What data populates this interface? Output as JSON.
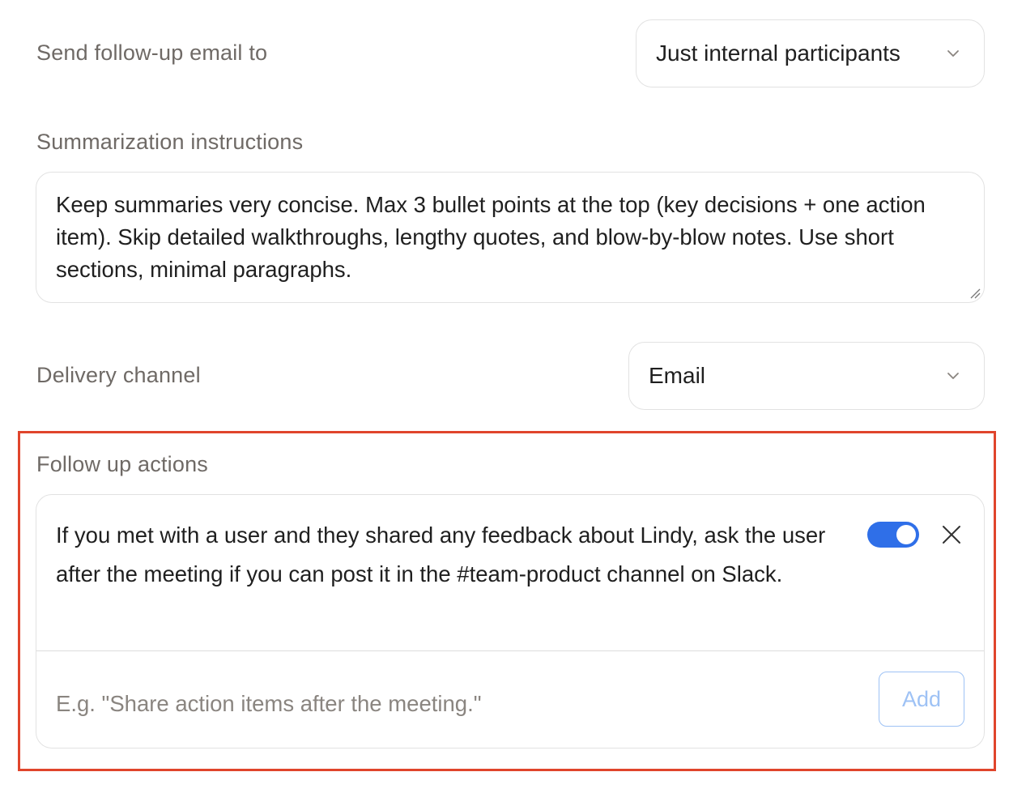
{
  "follow_up_email": {
    "label": "Send follow-up email to",
    "selected": "Just internal participants"
  },
  "summarization": {
    "label": "Summarization instructions",
    "text": "Keep summaries very concise. Max 3 bullet points at the top (key decisions + one action item). Skip detailed walkthroughs, lengthy quotes, and blow-by-blow notes. Use short sections, minimal paragraphs."
  },
  "delivery_channel": {
    "label": "Delivery channel",
    "selected": "Email"
  },
  "follow_up_actions": {
    "label": "Follow up actions",
    "items": [
      {
        "text": "If you met with a user and they shared any feedback about Lindy, ask the user after the meeting if you can post it in the #team-product channel on Slack.",
        "enabled": true
      }
    ],
    "new_action": {
      "value": "",
      "placeholder": "E.g. \"Share action items after the meeting.\"",
      "add_label": "Add"
    }
  },
  "colors": {
    "label_text": "#6f6a66",
    "toggle_on": "#2f6fe8",
    "highlight_border": "#e0452c",
    "add_button_disabled": "#9ec2f5"
  }
}
